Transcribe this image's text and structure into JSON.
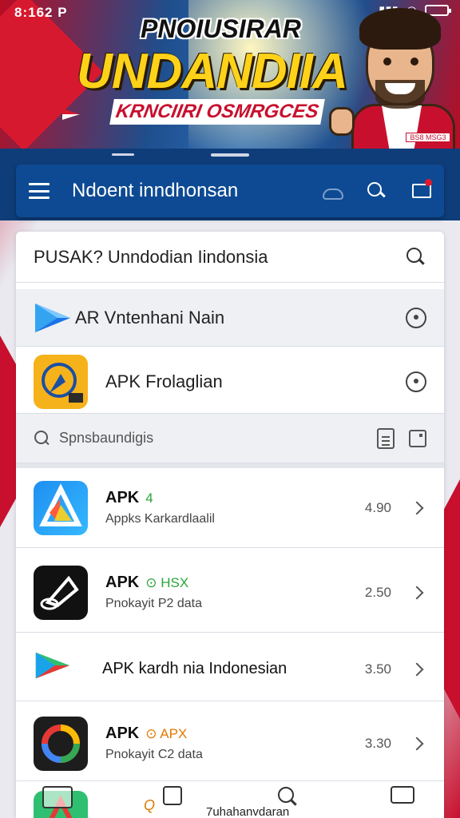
{
  "status_bar": {
    "time": "8:162 P"
  },
  "banner": {
    "line1": "PNOIUSIRAR",
    "line2": "UNDANDIIA",
    "line3": "KRNCIIRI OSMRGCES",
    "badge": "BS8 MSG3"
  },
  "appbar": {
    "title": "Ndoent inndhonsan"
  },
  "search": {
    "text": "PUSAK?  Unndodian Iindonsia"
  },
  "menu": [
    {
      "label": "AR Vntenhani Nain",
      "icon": "play-store-icon"
    },
    {
      "label": "APK Frolaglian",
      "icon": "app-globe-icon"
    }
  ],
  "sub_search": {
    "placeholder": "Spnsbaundigis"
  },
  "apps": [
    {
      "name": "APK",
      "tag": "4",
      "tag_color": "#2aa53a",
      "subtitle": "Appks Karkardlaalil",
      "size": "4.90"
    },
    {
      "name": "APK",
      "tag": "⊙ HSX",
      "tag_color": "#2aa53a",
      "subtitle": "Pnokayit P2 data",
      "size": "2.50"
    },
    {
      "name": "APK  kardh nia Indonesian",
      "tag": "",
      "tag_color": "#111111",
      "subtitle": "",
      "size": "3.50"
    },
    {
      "name": "APK",
      "tag": "⊙ APX",
      "tag_color": "#e07a00",
      "subtitle": "Pnokayit C2 data",
      "size": "3.30"
    }
  ],
  "bottom_nav": {
    "q": "Q",
    "label": "7uhahanvdaran"
  },
  "colors": {
    "appbar": "#0d4a93",
    "brand_red": "#c8102e",
    "banner_yellow": "#ffd21a"
  }
}
